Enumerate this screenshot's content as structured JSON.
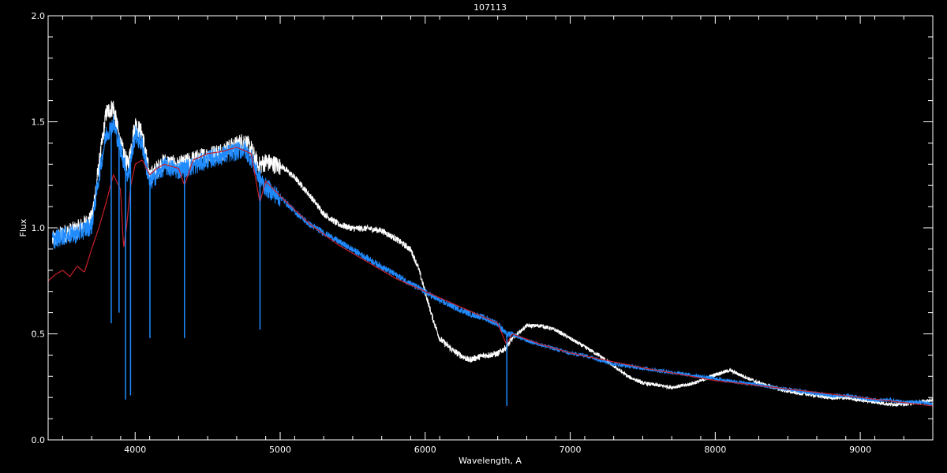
{
  "chart_data": {
    "type": "line",
    "title": "107113",
    "xlabel": "Wavelength, A",
    "ylabel": "Flux",
    "xlim": [
      3400,
      9500
    ],
    "ylim": [
      0.0,
      2.0
    ],
    "x_ticks": [
      "4000",
      "5000",
      "6000",
      "7000",
      "8000",
      "9000"
    ],
    "y_ticks": [
      "0.0",
      "0.5",
      "1.0",
      "1.5",
      "2.0"
    ],
    "background": "#000000",
    "grid": false,
    "legend": "none",
    "series": [
      {
        "color": "#ffffff",
        "x": [
          3430,
          3500,
          3600,
          3700,
          3750,
          3800,
          3850,
          3900,
          3950,
          4000,
          4050,
          4100,
          4200,
          4300,
          4400,
          4500,
          4600,
          4700,
          4750,
          4800,
          4850,
          4900,
          5000,
          5100,
          5200,
          5300,
          5400,
          5500,
          5600,
          5700,
          5800,
          5900,
          5950,
          6000,
          6050,
          6100,
          6200,
          6300,
          6400,
          6500,
          6560,
          6600,
          6700,
          6800,
          6900,
          7000,
          7100,
          7200,
          7300,
          7400,
          7500,
          7600,
          7700,
          7800,
          7900,
          8000,
          8100,
          8200,
          8300,
          8400,
          8500,
          8600,
          8700,
          8800,
          8900,
          9000,
          9100,
          9200,
          9300,
          9400,
          9500
        ],
        "values": [
          0.95,
          0.98,
          1.0,
          1.05,
          1.3,
          1.55,
          1.58,
          1.4,
          1.3,
          1.5,
          1.45,
          1.25,
          1.32,
          1.3,
          1.33,
          1.35,
          1.37,
          1.4,
          1.42,
          1.38,
          1.3,
          1.32,
          1.3,
          1.24,
          1.16,
          1.07,
          1.02,
          1.0,
          1.0,
          0.99,
          0.95,
          0.9,
          0.82,
          0.7,
          0.58,
          0.48,
          0.42,
          0.38,
          0.4,
          0.41,
          0.44,
          0.48,
          0.54,
          0.54,
          0.52,
          0.48,
          0.44,
          0.4,
          0.35,
          0.3,
          0.27,
          0.26,
          0.25,
          0.26,
          0.28,
          0.31,
          0.33,
          0.3,
          0.27,
          0.25,
          0.23,
          0.22,
          0.21,
          0.2,
          0.2,
          0.19,
          0.18,
          0.17,
          0.17,
          0.18,
          0.19
        ]
      },
      {
        "color": "#1f8bff",
        "x": [
          3430,
          3500,
          3600,
          3700,
          3750,
          3800,
          3850,
          3900,
          3950,
          4000,
          4050,
          4100,
          4200,
          4300,
          4400,
          4500,
          4600,
          4700,
          4750,
          4800,
          4850,
          4900,
          5000,
          5100,
          5200,
          5300,
          5400,
          5500,
          5600,
          5700,
          5800,
          5900,
          6000,
          6100,
          6200,
          6300,
          6400,
          6500,
          6560,
          6600,
          6700,
          6800,
          6900,
          7000,
          7100,
          7200,
          7300,
          7400,
          7500,
          7600,
          7700,
          7800,
          7900,
          8000,
          8100,
          8200,
          8300,
          8400,
          8500,
          8600,
          8700,
          8800,
          8900,
          9000,
          9100,
          9200,
          9300,
          9400,
          9500
        ],
        "values": [
          0.95,
          0.97,
          0.98,
          1.02,
          1.25,
          1.45,
          1.5,
          1.38,
          1.25,
          1.45,
          1.4,
          1.22,
          1.3,
          1.28,
          1.3,
          1.33,
          1.35,
          1.37,
          1.38,
          1.34,
          1.25,
          1.2,
          1.15,
          1.08,
          1.02,
          0.98,
          0.94,
          0.9,
          0.86,
          0.82,
          0.78,
          0.74,
          0.7,
          0.66,
          0.63,
          0.6,
          0.58,
          0.55,
          0.5,
          0.5,
          0.47,
          0.45,
          0.43,
          0.41,
          0.4,
          0.38,
          0.36,
          0.35,
          0.34,
          0.33,
          0.32,
          0.31,
          0.3,
          0.29,
          0.28,
          0.27,
          0.26,
          0.25,
          0.24,
          0.23,
          0.22,
          0.21,
          0.21,
          0.2,
          0.19,
          0.19,
          0.18,
          0.18,
          0.17
        ]
      },
      {
        "color": "#c8202a",
        "x": [
          3400,
          3450,
          3500,
          3550,
          3600,
          3650,
          3700,
          3750,
          3800,
          3850,
          3900,
          3920,
          3940,
          3970,
          4000,
          4050,
          4100,
          4150,
          4200,
          4300,
          4340,
          4400,
          4500,
          4600,
          4700,
          4800,
          4860,
          4900,
          5000,
          5200,
          5400,
          5600,
          5800,
          6000,
          6200,
          6400,
          6500,
          6560,
          6600,
          6800,
          7000,
          7500,
          8000,
          8500,
          9000,
          9500
        ],
        "values": [
          0.75,
          0.78,
          0.8,
          0.77,
          0.82,
          0.79,
          0.9,
          1.0,
          1.12,
          1.25,
          1.18,
          0.9,
          1.0,
          1.2,
          1.3,
          1.32,
          1.25,
          1.28,
          1.3,
          1.28,
          1.2,
          1.32,
          1.35,
          1.36,
          1.38,
          1.35,
          1.12,
          1.22,
          1.15,
          1.02,
          0.92,
          0.84,
          0.76,
          0.7,
          0.64,
          0.58,
          0.55,
          0.45,
          0.5,
          0.45,
          0.41,
          0.34,
          0.28,
          0.24,
          0.2,
          0.16
        ]
      },
      {
        "color": "#1f8bff",
        "x": [
          3400,
          9500
        ],
        "values": [
          0.0,
          0.0
        ]
      }
    ],
    "absorption_lines": [
      {
        "x": 3835,
        "depth_to": 0.55
      },
      {
        "x": 3889,
        "depth_to": 0.6
      },
      {
        "x": 3934,
        "depth_to": 0.19
      },
      {
        "x": 3968,
        "depth_to": 0.21
      },
      {
        "x": 4102,
        "depth_to": 0.48
      },
      {
        "x": 4340,
        "depth_to": 0.48
      },
      {
        "x": 4861,
        "depth_to": 0.52
      },
      {
        "x": 6563,
        "depth_to": 0.16
      }
    ]
  }
}
